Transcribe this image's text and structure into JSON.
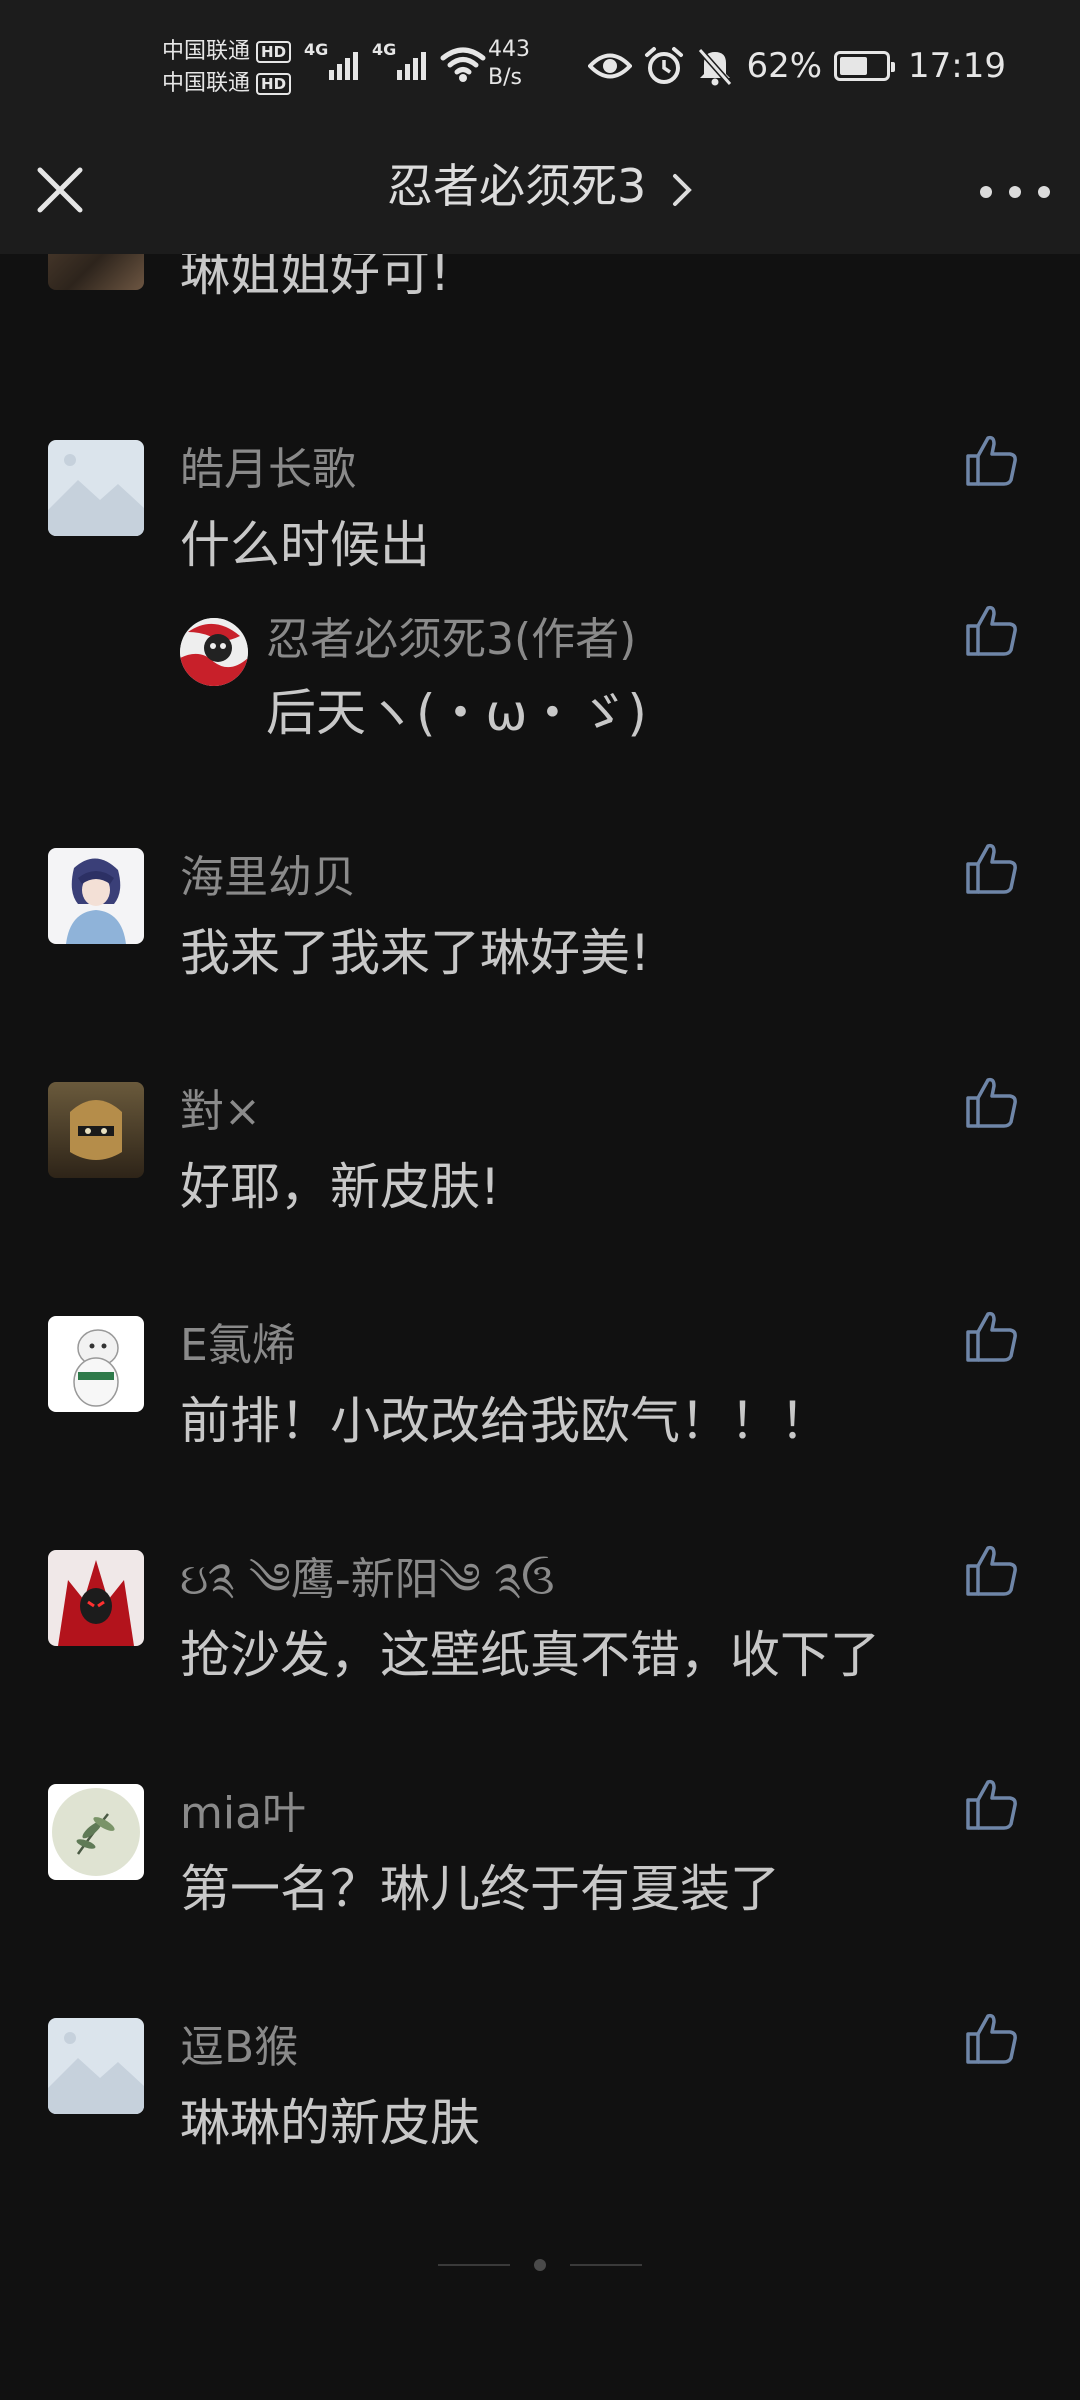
{
  "status_bar": {
    "carrier1": "中国联通",
    "carrier2": "中国联通",
    "hd": "HD",
    "net1": "4G",
    "net2": "4G",
    "speed_value": "443",
    "speed_unit": "B/s",
    "battery_percent": "62%",
    "battery_level": 0.62,
    "time": "17:19"
  },
  "header": {
    "title": "忍者必须死3"
  },
  "comments": [
    {
      "username": "",
      "text": "琳姐姐好可!",
      "avatar": "partial-avatar"
    },
    {
      "username": "皓月长歌",
      "text": "什么时候出",
      "avatar": "placeholder-avatar"
    },
    {
      "username": "忍者必须死3(作者)",
      "text": "后天ヽ(・ω・ゞ)",
      "avatar": "author-logo",
      "is_reply": true
    },
    {
      "username": "海里幼贝",
      "text": "我来了我来了琳好美!",
      "avatar": "anime-avatar"
    },
    {
      "username": "對×",
      "text": "好耶，新皮肤!",
      "avatar": "helmet-avatar"
    },
    {
      "username": "E氯烯",
      "text": "前排！小改改给我欧气！！！",
      "avatar": "bear-avatar"
    },
    {
      "username": "ઇ༉ ༄鹰-新阳༄ ༉ઉ",
      "text": "抢沙发，这壁纸真不错，收下了",
      "avatar": "demon-avatar"
    },
    {
      "username": "mia叶",
      "text": "第一名？琳儿终于有夏装了",
      "avatar": "plant-avatar"
    },
    {
      "username": "逗B猴",
      "text": "琳琳的新皮肤",
      "avatar": "placeholder-avatar"
    }
  ],
  "colors": {
    "background": "#111111",
    "header": "#1c1c1c",
    "like_icon": "#6f86a8",
    "username": "#8a8a8a",
    "text": "#c8c8c8"
  }
}
